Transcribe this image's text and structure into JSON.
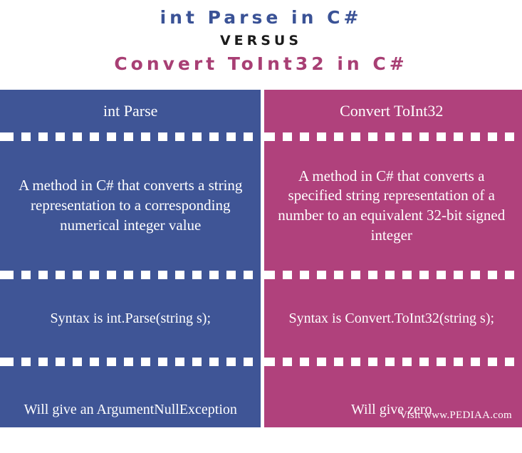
{
  "header": {
    "title_left": "int Parse in C#",
    "versus": "VERSUS",
    "title_right": "Convert ToInt32 in C#",
    "color_left": "#3a5296",
    "color_right": "#a83f74"
  },
  "columns": [
    {
      "heading": "int Parse",
      "background": "#3f5596",
      "rows": [
        "A method in C# that converts a string representation to a corresponding numerical integer value",
        "Syntax is int.Parse(string s);",
        "Will give an ArgumentNullException"
      ]
    },
    {
      "heading": "Convert ToInt32",
      "background": "#b0417c",
      "rows": [
        "A method in C# that converts a specified string representation of a number to an equivalent 32-bit signed integer",
        "Syntax is Convert.ToInt32(string s);",
        "Will give zero"
      ]
    }
  ],
  "footer": {
    "visit": "Visit www.PEDIAA.com"
  }
}
